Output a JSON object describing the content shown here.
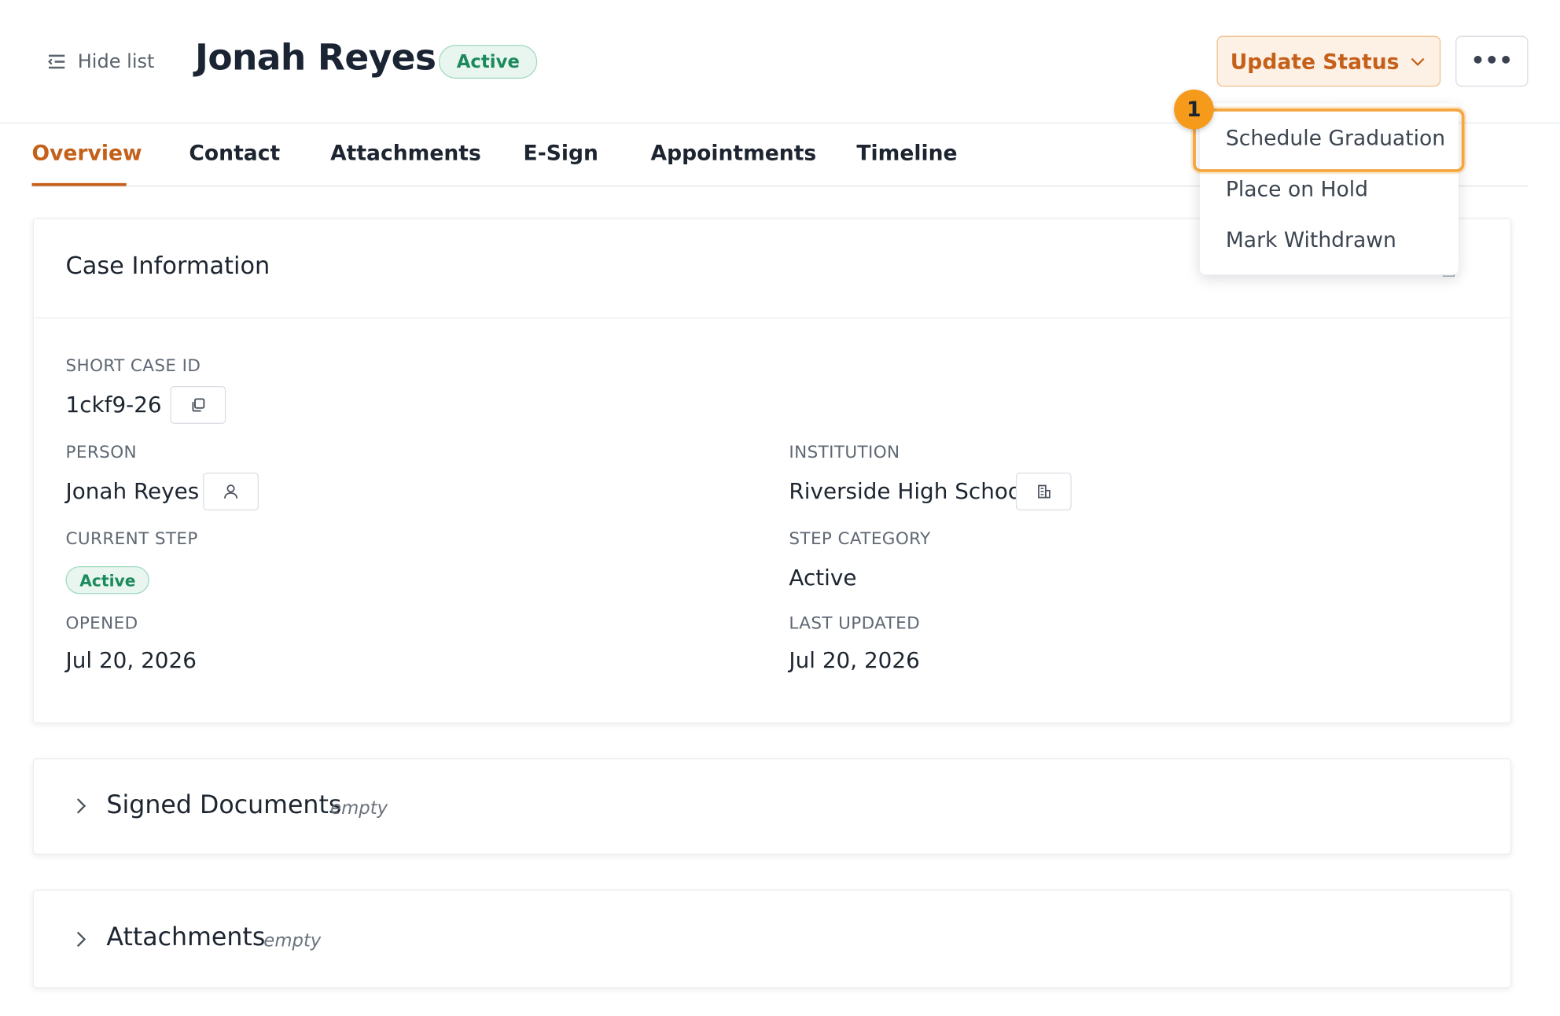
{
  "header": {
    "hide_list_label": "Hide list",
    "title": "Jonah Reyes",
    "status_badge": "Active",
    "update_status_label": "Update Status",
    "more_label": "•••"
  },
  "tabs": [
    {
      "label": "Overview",
      "active": true
    },
    {
      "label": "Contact"
    },
    {
      "label": "Attachments"
    },
    {
      "label": "E-Sign"
    },
    {
      "label": "Appointments"
    },
    {
      "label": "Timeline"
    }
  ],
  "case_info": {
    "title": "Case Information",
    "short_case_id_label": "SHORT CASE ID",
    "short_case_id": "1ckf9-26",
    "person_label": "PERSON",
    "person": "Jonah Reyes",
    "institution_label": "INSTITUTION",
    "institution": "Riverside High School",
    "current_step_label": "CURRENT STEP",
    "current_step": "Active",
    "step_category_label": "STEP CATEGORY",
    "step_category": "Active",
    "opened_label": "OPENED",
    "opened": "Jul 20, 2026",
    "last_updated_label": "LAST UPDATED",
    "last_updated": "Jul 20, 2026"
  },
  "sections": {
    "signed_documents": {
      "title": "Signed Documents",
      "note": "empty"
    },
    "attachments": {
      "title": "Attachments",
      "note": "empty"
    }
  },
  "status_menu": {
    "items": [
      "Schedule Graduation",
      "Place on Hold",
      "Mark Withdrawn"
    ],
    "highlighted": "Schedule Graduation"
  },
  "annotation": {
    "marker": "1"
  },
  "colors": {
    "accent": "#c4601a",
    "active_green": "#1c8a5c",
    "highlight": "#f5a640"
  }
}
